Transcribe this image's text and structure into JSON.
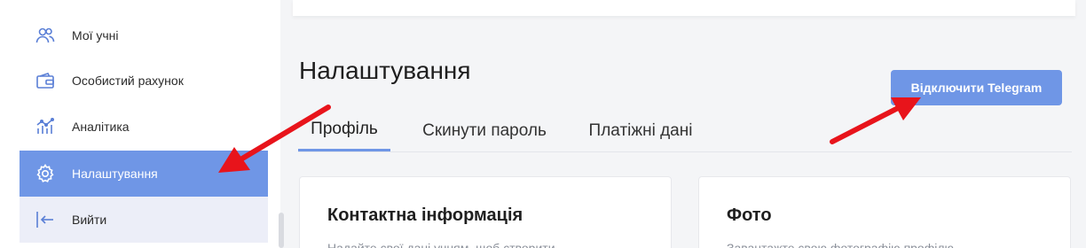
{
  "sidebar": {
    "items": [
      {
        "label": "Мої учні",
        "icon": "users-icon"
      },
      {
        "label": "Особистий рахунок",
        "icon": "wallet-icon"
      },
      {
        "label": "Аналітика",
        "icon": "analytics-icon"
      },
      {
        "label": "Налаштування",
        "icon": "gear-icon",
        "active": true
      },
      {
        "label": "Вийти",
        "icon": "logout-icon"
      }
    ]
  },
  "page": {
    "title": "Налаштування",
    "telegram_button": "Відключити Telegram"
  },
  "tabs": [
    {
      "label": "Профіль",
      "active": true
    },
    {
      "label": "Скинути пароль"
    },
    {
      "label": "Платіжні дані"
    }
  ],
  "cards": {
    "contact": {
      "title": "Контактна інформація",
      "subtitle": "Надайте свої дані учням, щоб створити"
    },
    "photo": {
      "title": "Фото",
      "subtitle": "Завантажте свою фотографію профілю"
    }
  },
  "colors": {
    "accent": "#6f96e6",
    "arrow": "#e8141b",
    "hover": "#eceef8"
  }
}
